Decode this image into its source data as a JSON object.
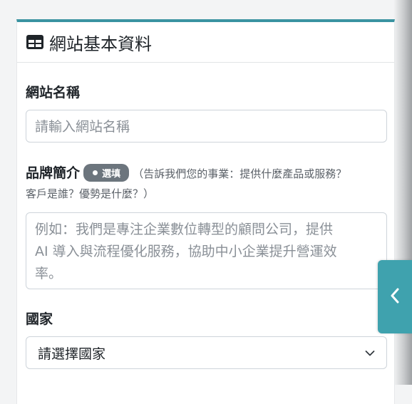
{
  "card": {
    "title": "網站基本資料"
  },
  "site_name": {
    "label": "網站名稱",
    "placeholder": "請輸入網站名稱"
  },
  "brand_intro": {
    "label": "品牌簡介",
    "badge": "選填",
    "hint_line1": "（告訴我們您的事業：提供什麼產品或服務？",
    "hint_line2": "客戶是誰？優勢是什麼？）",
    "placeholder_line1": "例如：我們是專注企業數位轉型的顧問公司，提供",
    "placeholder_line2": "AI 導入與流程優化服務，協助中小企業提升營運效",
    "placeholder_line3": "率。"
  },
  "country": {
    "label": "國家",
    "selected": "請選擇國家"
  },
  "icons": {
    "header": "table-icon",
    "select": "chevron-down-icon",
    "toggle": "chevron-left-icon"
  },
  "colors": {
    "accent": "#3a93a1",
    "toggle": "#3fa2ae",
    "badge": "#6c757d"
  }
}
